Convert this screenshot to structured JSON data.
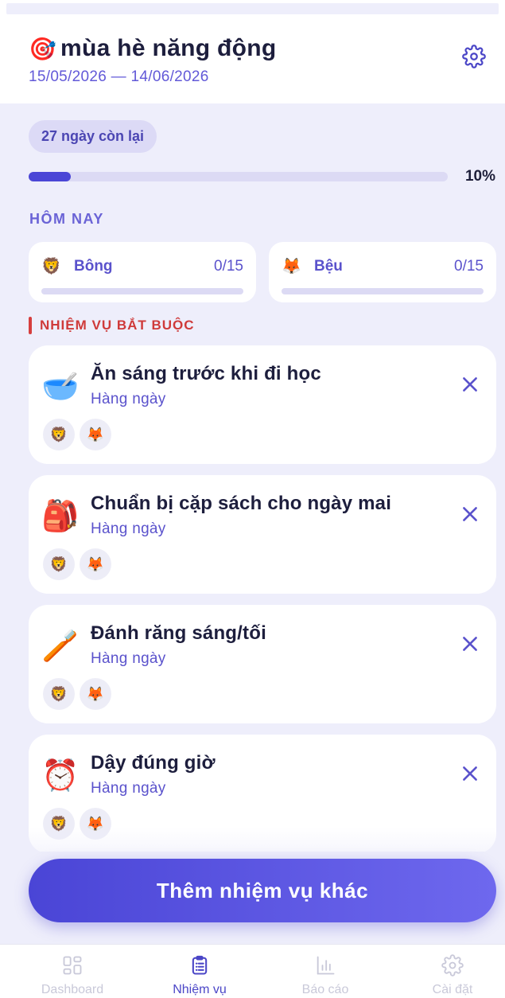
{
  "header": {
    "emoji": "🎯",
    "title": "mùa hè năng động",
    "dates": "15/05/2026 — 14/06/2026"
  },
  "summary": {
    "days_left": "27 ngày còn lại",
    "progress_percent": 10,
    "progress_label": "10%"
  },
  "today": {
    "label": "HÔM NAY",
    "kids": [
      {
        "avatar": "🦁",
        "name": "Bông",
        "count": "0/15",
        "progress": 0
      },
      {
        "avatar": "🦊",
        "name": "Bệu",
        "count": "0/15",
        "progress": 0
      }
    ]
  },
  "required": {
    "label": "NHIỆM VỤ BẮT BUỘC",
    "tasks": [
      {
        "icon": "🥣",
        "name": "Ăn sáng trước khi đi học",
        "frequency": "Hàng ngày",
        "assignees": [
          "🦁",
          "🦊"
        ]
      },
      {
        "icon": "🎒",
        "name": "Chuẩn bị cặp sách cho ngày mai",
        "frequency": "Hàng ngày",
        "assignees": [
          "🦁",
          "🦊"
        ]
      },
      {
        "icon": "🪥",
        "name": "Đánh răng sáng/tối",
        "frequency": "Hàng ngày",
        "assignees": [
          "🦁",
          "🦊"
        ]
      },
      {
        "icon": "⏰",
        "name": "Dậy đúng giờ",
        "frequency": "Hàng ngày",
        "assignees": [
          "🦁",
          "🦊"
        ]
      }
    ]
  },
  "cta": {
    "label": "Thêm nhiệm vụ khác"
  },
  "tabbar": {
    "tabs": [
      {
        "label": "Dashboard",
        "icon": "grid-icon",
        "active": false
      },
      {
        "label": "Nhiệm vụ",
        "icon": "clipboard-list-icon",
        "active": true
      },
      {
        "label": "Báo cáo",
        "icon": "bar-chart-icon",
        "active": false
      },
      {
        "label": "Cài đặt",
        "icon": "gear-icon",
        "active": false
      }
    ]
  },
  "colors": {
    "accent": "#4b46d6",
    "background": "#eeeefb",
    "danger": "#cf3a3a",
    "inactive_tab": "#c9c9d9"
  }
}
